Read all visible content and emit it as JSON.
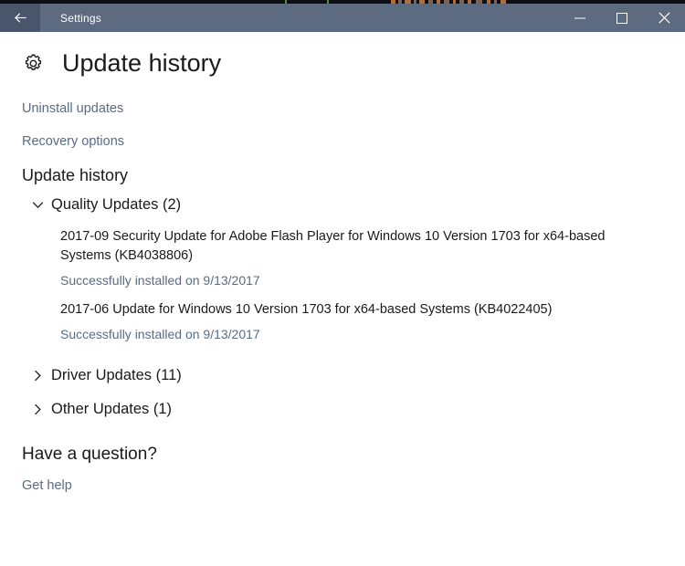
{
  "titlebar": {
    "back_icon": "back-arrow-icon",
    "title": "Settings",
    "minimize_label": "Minimize",
    "maximize_label": "Maximize",
    "close_label": "Close"
  },
  "page": {
    "icon": "gear-icon",
    "title": "Update history"
  },
  "top_links": [
    {
      "label": "Uninstall updates",
      "name": "uninstall-updates-link"
    },
    {
      "label": "Recovery options",
      "name": "recovery-options-link"
    }
  ],
  "section": {
    "title": "Update history"
  },
  "groups": [
    {
      "label": "Quality Updates (2)",
      "name": "group-quality-updates",
      "expanded": true,
      "chevron": "chevron-down-icon",
      "items": [
        {
          "title": "2017-09 Security Update for Adobe Flash Player for Windows 10 Version 1703 for x64-based Systems (KB4038806)",
          "status": "Successfully installed on 9/13/2017"
        },
        {
          "title": "2017-06 Update for Windows 10 Version 1703 for x64-based Systems (KB4022405)",
          "status": "Successfully installed on 9/13/2017"
        }
      ]
    },
    {
      "label": "Driver Updates (11)",
      "name": "group-driver-updates",
      "expanded": false,
      "chevron": "chevron-right-icon",
      "items": []
    },
    {
      "label": "Other Updates (1)",
      "name": "group-other-updates",
      "expanded": false,
      "chevron": "chevron-right-icon",
      "items": []
    }
  ],
  "help": {
    "title": "Have a question?",
    "link": "Get help"
  },
  "colors": {
    "titlebar": "#5d6b80",
    "back_button": "#49556b",
    "link": "#5a6b85",
    "text": "#1a1a1a",
    "background": "#ffffff"
  }
}
